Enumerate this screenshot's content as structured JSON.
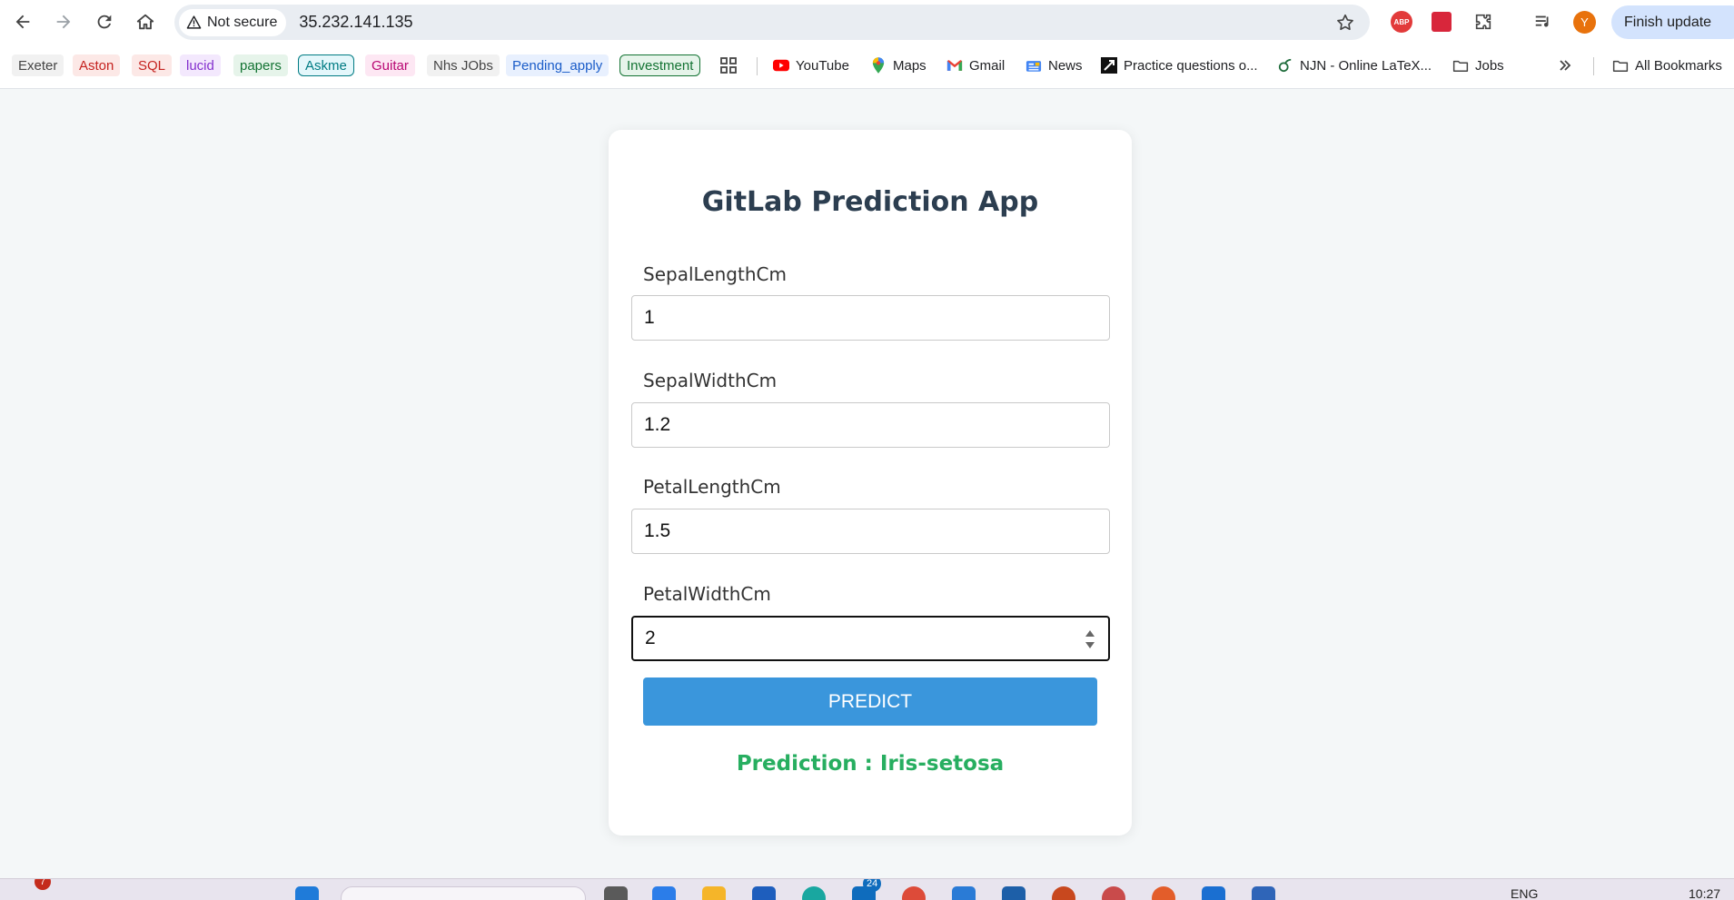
{
  "browser": {
    "security_label": "Not secure",
    "url": "35.232.141.135",
    "finish_update_label": "Finish update",
    "avatar_initial": "Y",
    "bookmarks": [
      {
        "label": "Exeter",
        "color": "#444444",
        "bg": "#f1f1f1"
      },
      {
        "label": "Aston",
        "color": "#c5221f",
        "bg": "#fce8e6"
      },
      {
        "label": "SQL",
        "color": "#c5221f",
        "bg": "#fce8e6"
      },
      {
        "label": "lucid",
        "color": "#8430ce",
        "bg": "#f3e8fd"
      },
      {
        "label": "papers",
        "color": "#137333",
        "bg": "#e6f4ea"
      },
      {
        "label": "Askme",
        "color": "#007b83",
        "bg": "#e4f7fb"
      },
      {
        "label": "Guitar",
        "color": "#b80672",
        "bg": "#fde7f3"
      },
      {
        "label": "Nhs JObs",
        "color": "#444444",
        "bg": "#f1f1f1"
      },
      {
        "label": "Pending_apply",
        "color": "#1a5cc8",
        "bg": "#e8f0fe"
      },
      {
        "label": "Investment",
        "color": "#137333",
        "bg": "#e6f4ea"
      }
    ],
    "bookmark_links": {
      "youtube": "YouTube",
      "maps": "Maps",
      "gmail": "Gmail",
      "news": "News",
      "practice": "Practice questions o...",
      "njn": "NJN - Online LaTeX...",
      "jobs": "Jobs",
      "all_bookmarks": "All Bookmarks"
    }
  },
  "app": {
    "title": "GitLab Prediction App",
    "fields": [
      {
        "label": "SepalLengthCm",
        "value": "1"
      },
      {
        "label": "SepalWidthCm",
        "value": "1.2"
      },
      {
        "label": "PetalLengthCm",
        "value": "1.5"
      },
      {
        "label": "PetalWidthCm",
        "value": "2"
      }
    ],
    "predict_label": "PREDICT",
    "prediction_text": "Prediction : Iris-setosa"
  },
  "taskbar": {
    "widget_badge": "7",
    "app_badge": "24",
    "language": "ENG",
    "time": "10:27"
  }
}
